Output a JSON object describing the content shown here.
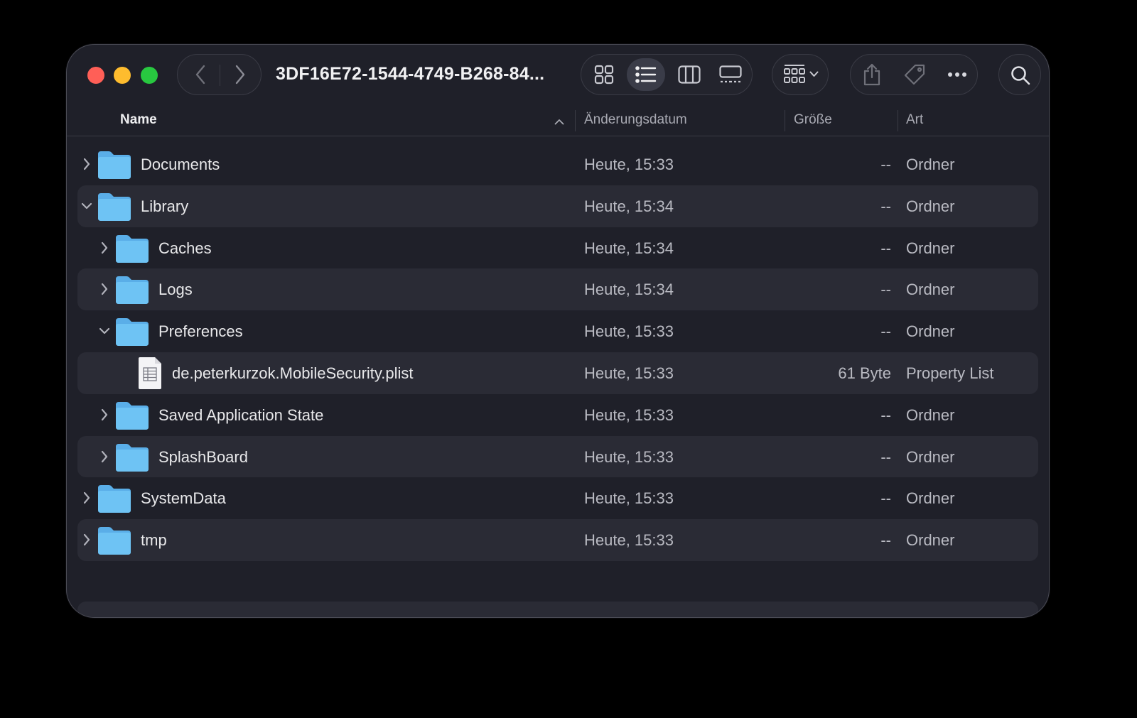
{
  "window": {
    "title": "3DF16E72-1544-4749-B268-84..."
  },
  "toolbar": {
    "back_icon": "chevron-left-icon",
    "forward_icon": "chevron-right-icon",
    "views": [
      "icon-view",
      "list-view",
      "column-view",
      "gallery-view"
    ],
    "selected_view": "list-view",
    "group_icon": "group-by-icon",
    "share_icon": "share-icon",
    "tag_icon": "tag-icon",
    "more_icon": "more-icon",
    "search_icon": "search-icon"
  },
  "columns": {
    "name": "Name",
    "date": "Änderungsdatum",
    "size": "Größe",
    "kind": "Art"
  },
  "rows": [
    {
      "name": "Documents",
      "date": "Heute, 15:33",
      "size": "--",
      "kind": "Ordner",
      "type": "folder",
      "level": 0,
      "expanded": false
    },
    {
      "name": "Library",
      "date": "Heute, 15:34",
      "size": "--",
      "kind": "Ordner",
      "type": "folder",
      "level": 0,
      "expanded": true
    },
    {
      "name": "Caches",
      "date": "Heute, 15:34",
      "size": "--",
      "kind": "Ordner",
      "type": "folder",
      "level": 1,
      "expanded": false
    },
    {
      "name": "Logs",
      "date": "Heute, 15:34",
      "size": "--",
      "kind": "Ordner",
      "type": "folder",
      "level": 1,
      "expanded": false
    },
    {
      "name": "Preferences",
      "date": "Heute, 15:33",
      "size": "--",
      "kind": "Ordner",
      "type": "folder",
      "level": 1,
      "expanded": true
    },
    {
      "name": "de.peterkurzok.MobileSecurity.plist",
      "date": "Heute, 15:33",
      "size": "61 Byte",
      "kind": "Property List",
      "type": "file",
      "level": 2
    },
    {
      "name": "Saved Application State",
      "date": "Heute, 15:33",
      "size": "--",
      "kind": "Ordner",
      "type": "folder",
      "level": 1,
      "expanded": false
    },
    {
      "name": "SplashBoard",
      "date": "Heute, 15:33",
      "size": "--",
      "kind": "Ordner",
      "type": "folder",
      "level": 1,
      "expanded": false
    },
    {
      "name": "SystemData",
      "date": "Heute, 15:33",
      "size": "--",
      "kind": "Ordner",
      "type": "folder",
      "level": 0,
      "expanded": false
    },
    {
      "name": "tmp",
      "date": "Heute, 15:33",
      "size": "--",
      "kind": "Ordner",
      "type": "folder",
      "level": 0,
      "expanded": false
    }
  ],
  "colors": {
    "window_bg": "#1f2029",
    "row_alt": "#2a2b35",
    "folder_blue": "#6ec3f4",
    "close": "#ff5f57",
    "minimize": "#febc2e",
    "maximize": "#28c840"
  }
}
